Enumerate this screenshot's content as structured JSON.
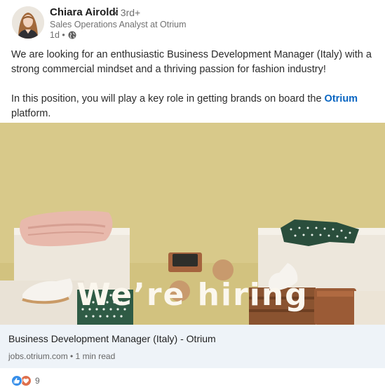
{
  "author": {
    "name": "Chiara Airoldi",
    "degree": "• 3rd+",
    "headline": "Sales Operations Analyst at Otrium",
    "time": "1d •"
  },
  "post": {
    "paragraph1": "We are looking for an enthusiastic Business Development Manager (Italy) with a strong commercial mindset and a thriving passion for fashion industry!",
    "paragraph2_before": "In this position, you will play a key role in getting brands on board the ",
    "paragraph2_mention": "Otrium",
    "paragraph2_after": " platform."
  },
  "image": {
    "headline": "We’re hiring",
    "colors": {
      "background": "#d9ca8c",
      "text": "#fbf7ee"
    }
  },
  "link_card": {
    "title": "Business Development Manager (Italy) - Otrium",
    "source": "jobs.otrium.com • 1 min read"
  },
  "reactions": {
    "count": "9",
    "types": [
      "like-icon",
      "love-icon"
    ]
  },
  "colors": {
    "link": "#0a66c2",
    "card_bg": "#eef3f8"
  }
}
